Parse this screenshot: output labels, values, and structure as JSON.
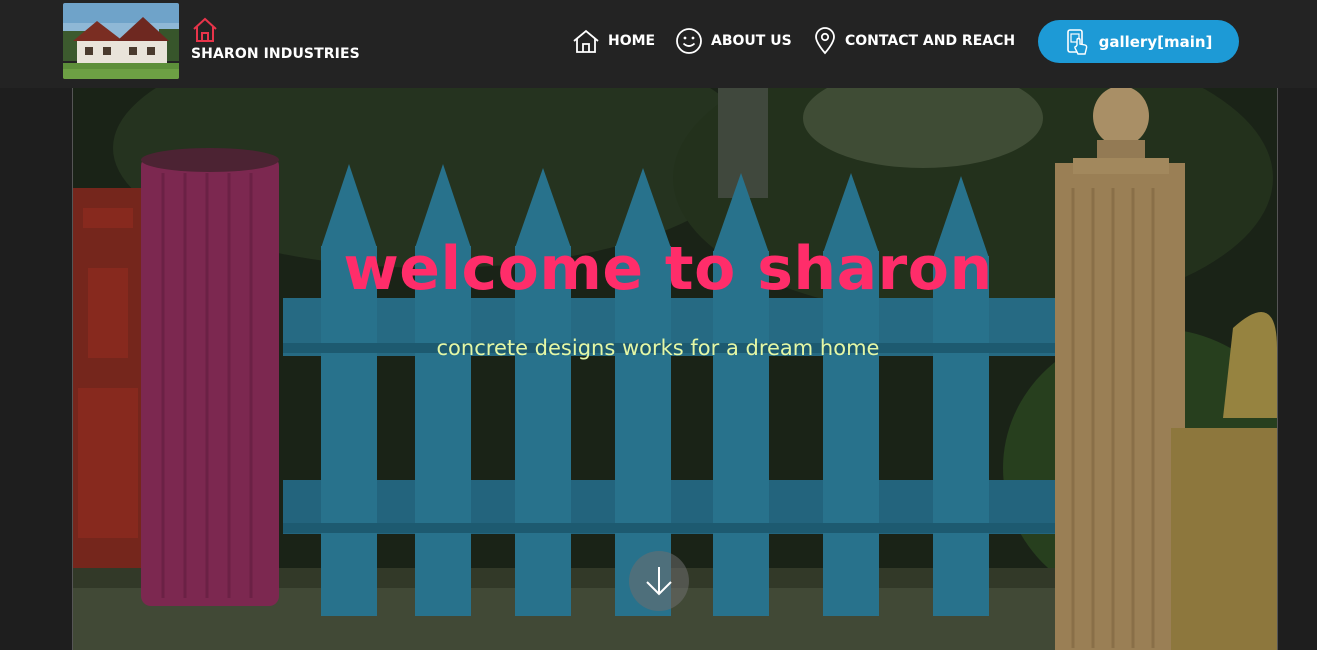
{
  "brand": {
    "name": "SHARON INDUSTRIES",
    "logo_icon": "house-outline-icon"
  },
  "nav": {
    "items": [
      {
        "label": "HOME",
        "icon": "home-icon"
      },
      {
        "label": "ABOUT US",
        "icon": "smiley-icon"
      },
      {
        "label": "CONTACT AND REACH",
        "icon": "map-pin-icon"
      }
    ],
    "gallery_button": {
      "label": "gallery[main]",
      "icon": "touch-phone-icon"
    }
  },
  "hero": {
    "title": "welcome to sharon",
    "subtitle": "concrete designs works for a dream home",
    "scroll_icon": "arrow-down-icon"
  },
  "colors": {
    "navbar": "#232323",
    "accent_button": "#1d9ad6",
    "title": "#ff2d6a",
    "subtitle": "#e4f7a6",
    "brand_icon": "#e8344a"
  }
}
